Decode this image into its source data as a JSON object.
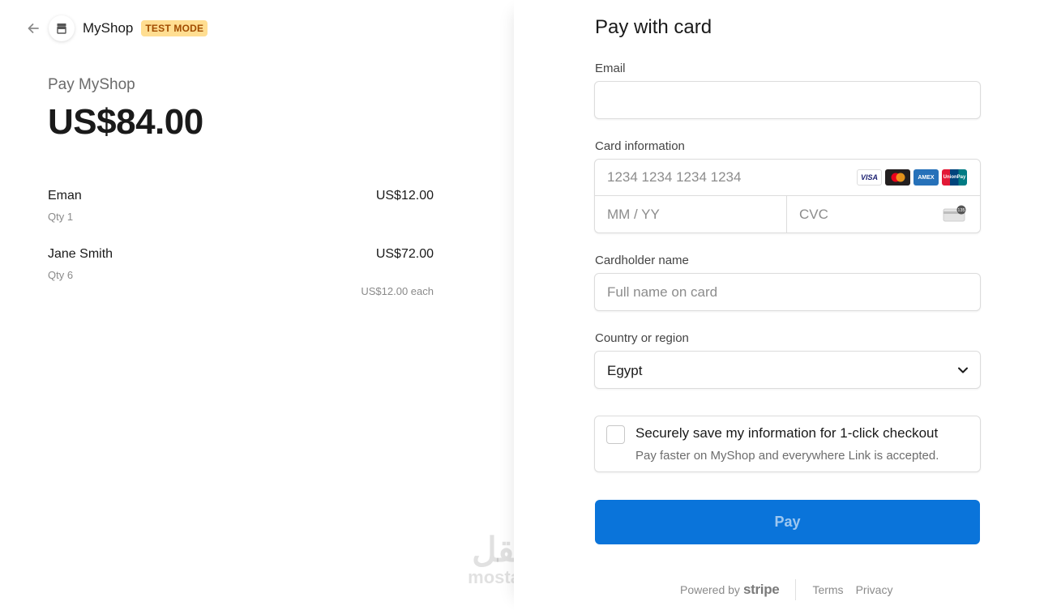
{
  "header": {
    "shop_name": "MyShop",
    "badge": "TEST MODE"
  },
  "summary": {
    "pay_title": "Pay MyShop",
    "total": "US$84.00",
    "items": [
      {
        "name": "Eman",
        "qty": "Qty 1",
        "price": "US$12.00",
        "each": ""
      },
      {
        "name": "Jane Smith",
        "qty": "Qty 6",
        "price": "US$72.00",
        "each": "US$12.00 each"
      }
    ]
  },
  "watermark": {
    "arabic": "مستقل",
    "latin": "mostaql.com"
  },
  "form": {
    "title": "Pay with card",
    "email": {
      "label": "Email",
      "value": "",
      "placeholder": ""
    },
    "card": {
      "label": "Card information",
      "number_placeholder": "1234 1234 1234 1234",
      "expiry_placeholder": "MM / YY",
      "cvc_placeholder": "CVC",
      "brands": [
        "visa",
        "mastercard",
        "amex",
        "unionpay"
      ]
    },
    "cardholder": {
      "label": "Cardholder name",
      "placeholder": "Full name on card"
    },
    "country": {
      "label": "Country or region",
      "value": "Egypt"
    },
    "save": {
      "title": "Securely save my information for 1-click checkout",
      "subtitle": "Pay faster on MyShop and everywhere Link is accepted.",
      "checked": false
    },
    "pay_button": "Pay"
  },
  "footer": {
    "powered_by": "Powered by",
    "brand": "stripe",
    "terms": "Terms",
    "privacy": "Privacy"
  },
  "colors": {
    "accent": "#0a74da",
    "badge_bg": "#ffde92",
    "badge_text": "#a14c00"
  }
}
